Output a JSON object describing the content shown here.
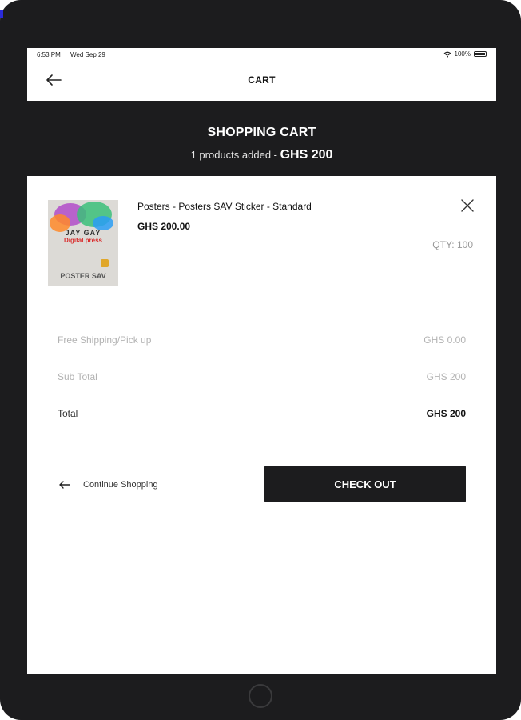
{
  "status_bar": {
    "time": "6:53 PM",
    "date": "Wed Sep 29",
    "battery": "100%"
  },
  "header": {
    "title": "CART"
  },
  "banner": {
    "title": "SHOPPING CART",
    "count_text": "1 products added - ",
    "amount": "GHS  200"
  },
  "cart_item": {
    "name": "Posters  - Posters SAV Sticker - Standard",
    "price": "GHS 200.00",
    "qty": "QTY: 100",
    "image_brand": "JAY GAY",
    "image_brand2": "Digital press",
    "image_label": "POSTER SAV"
  },
  "summary": {
    "shipping_label": "Free Shipping/Pick up",
    "shipping_value": "GHS 0.00",
    "subtotal_label": "Sub Total",
    "subtotal_value": "GHS 200",
    "total_label": "Total",
    "total_value": "GHS 200"
  },
  "actions": {
    "continue_label": "Continue Shopping",
    "checkout_label": "CHECK OUT"
  },
  "colors": {
    "dark": "#1c1c1e",
    "muted": "#b3b3b3",
    "divider": "#e4e4e4",
    "corner_mark": "#2b2bd9"
  },
  "icons": {
    "back": "arrow-left-icon",
    "close": "close-icon",
    "continue": "arrow-left-icon",
    "wifi": "wifi-icon",
    "battery": "battery-icon",
    "home": "home-button-icon"
  }
}
